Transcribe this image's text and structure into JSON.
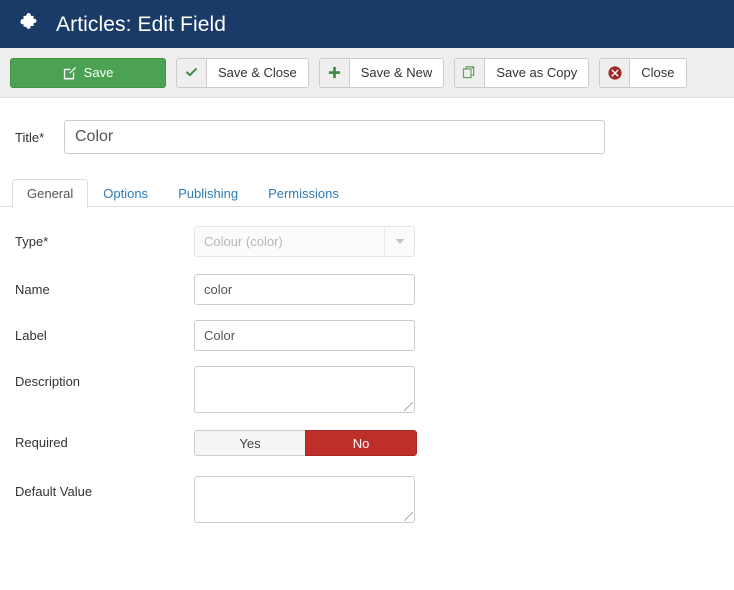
{
  "header": {
    "icon": "puzzle-piece-icon",
    "title": "Articles: Edit Field"
  },
  "toolbar": {
    "buttons": [
      {
        "label": "Save",
        "icon": "edit-square-icon",
        "style": "primary",
        "accent": "#4aa252"
      },
      {
        "label": "Save & Close",
        "icon": "check-icon",
        "style": "split",
        "accent": "#3d8b40"
      },
      {
        "label": "Save & New",
        "icon": "plus-icon",
        "style": "split",
        "accent": "#3d8b40"
      },
      {
        "label": "Save as Copy",
        "icon": "copy-icon",
        "style": "split",
        "accent": "#6aa05f"
      },
      {
        "label": "Close",
        "icon": "circle-x-icon",
        "style": "split",
        "accent": "#a02824"
      }
    ]
  },
  "title_field": {
    "label": "Title",
    "required_marker": "*",
    "value": "Color",
    "placeholder": ""
  },
  "tabs": [
    {
      "label": "General",
      "active": true
    },
    {
      "label": "Options",
      "active": false
    },
    {
      "label": "Publishing",
      "active": false
    },
    {
      "label": "Permissions",
      "active": false
    }
  ],
  "form": {
    "type": {
      "label": "Type",
      "required_marker": "*",
      "value": "Colour (color)",
      "disabled": true,
      "caret_icon": "chevron-down-icon"
    },
    "name": {
      "label": "Name",
      "value": "color",
      "placeholder": ""
    },
    "field_label": {
      "label": "Label",
      "value": "Color",
      "placeholder": ""
    },
    "description": {
      "label": "Description",
      "value": "",
      "placeholder": ""
    },
    "required": {
      "label": "Required",
      "option_yes": "Yes",
      "option_no": "No",
      "selected": "No",
      "active_color": "#bf2f29"
    },
    "default_value": {
      "label": "Default Value",
      "value": "",
      "placeholder": ""
    }
  },
  "colors": {
    "header_bg": "#1a3a67",
    "toolbar_bg": "#eeeeee",
    "primary_green": "#4aa252",
    "link_blue": "#2e7bb5",
    "danger_red": "#bf2f29"
  }
}
